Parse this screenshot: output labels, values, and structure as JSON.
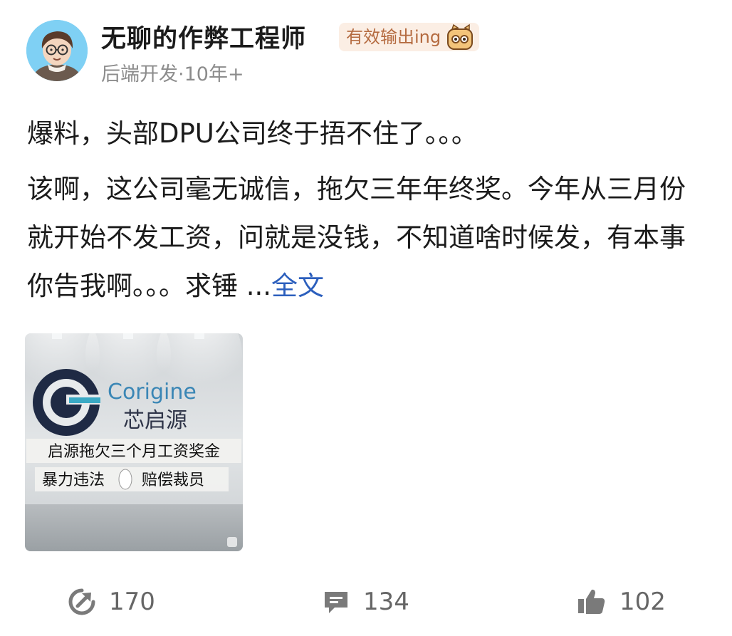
{
  "author": {
    "name": "无聊的作弊工程师",
    "badge": "有效输出ing",
    "meta": "后端开发·10年+"
  },
  "post": {
    "title": "爆料，头部DPU公司终于捂不住了。。。",
    "body": "该啊，这公司毫无诚信，拖欠三年年终奖。今年从三月份就开始不发工资，问就是没钱，不知道啥时候发，有本事你告我啊。。。求锤 ...",
    "more_link": "全文"
  },
  "image": {
    "brand_en": "Corigine",
    "brand_cn": "芯启源",
    "banner_line1": "启源拖欠三个月工资奖金",
    "banner_line2": "暴力违法",
    "banner_line2b": "赔偿裁员"
  },
  "actions": {
    "share_count": "170",
    "comment_count": "134",
    "like_count": "102"
  },
  "icons": {
    "share": "share-icon",
    "comment": "comment-icon",
    "like": "thumbs-up-icon"
  },
  "colors": {
    "link": "#2c5fbd",
    "badge_bg": "#fbeee4",
    "badge_text": "#b46a3f",
    "icon_gray": "#7a7a7a"
  }
}
